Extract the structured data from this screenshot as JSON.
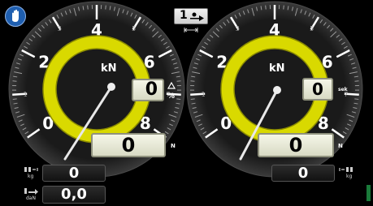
{
  "colors": {
    "accent": "#e6e600",
    "lcd_bg": "#eceedd",
    "bg": "#000000",
    "hand_button": "#1f5fb0"
  },
  "top_indicator": {
    "value": "1",
    "icon": "tractor-arrow-icon",
    "sub_icon": "width-arrows-icon"
  },
  "gauge_left": {
    "unit": "kN",
    "major_ticks": [
      "0",
      "2",
      "4",
      "6",
      "8"
    ],
    "minor_ticks": [
      "1",
      "3",
      "5",
      "7"
    ],
    "needle_value": 0,
    "main_readout": "0",
    "main_unit": "N",
    "aux_readout": "0",
    "aux_unit": "%",
    "aux_icon": "delta-icon"
  },
  "gauge_right": {
    "unit": "kN",
    "major_ticks": [
      "0",
      "2",
      "4",
      "6",
      "8"
    ],
    "minor_ticks": [
      "1",
      "3",
      "5",
      "7"
    ],
    "needle_value": 0,
    "main_readout": "0",
    "main_unit": "N",
    "aux_readout": "0",
    "aux_unit": "sek"
  },
  "bottom_left": {
    "row1": {
      "value": "0",
      "unit": "kg",
      "icon": "axle-weight-icon"
    },
    "row2": {
      "value": "0,0",
      "unit": "daN",
      "icon": "draft-force-icon"
    }
  },
  "bottom_right": {
    "row1": {
      "value": "0",
      "unit": "kg",
      "icon": "axle-weight-icon"
    }
  }
}
